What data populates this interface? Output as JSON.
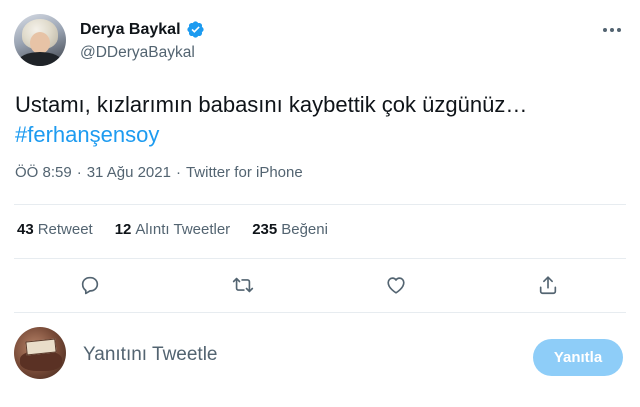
{
  "author": {
    "display_name": "Derya Baykal",
    "handle": "@DDeryaBaykal",
    "verified_icon": "verified-badge-icon"
  },
  "tweet": {
    "text": "Ustamı, kızlarımın babasını kaybettik çok üzgünüz…",
    "hashtag": "#ferhanşensoy"
  },
  "meta": {
    "time": "ÖÖ 8:59",
    "separator1": "·",
    "date": "31 Ağu 2021",
    "separator2": "·",
    "source": "Twitter for iPhone"
  },
  "stats": [
    {
      "count": "43",
      "label": "Retweet"
    },
    {
      "count": "12",
      "label": "Alıntı Tweetler"
    },
    {
      "count": "235",
      "label": "Beğeni"
    }
  ],
  "actions": [
    "reply-icon",
    "retweet-icon",
    "like-icon",
    "share-icon"
  ],
  "reply": {
    "placeholder": "Yanıtını Tweetle",
    "button_label": "Yanıtla"
  },
  "colors": {
    "accent": "#1d9bf0",
    "reply_button_disabled": "#8ecdf8",
    "secondary_text": "#536471",
    "divider": "#e7ecf0"
  }
}
